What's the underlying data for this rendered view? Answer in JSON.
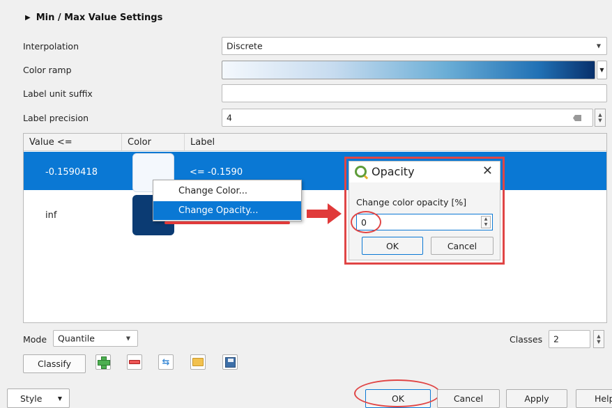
{
  "section": {
    "title": "Min / Max Value Settings"
  },
  "form": {
    "interpolation_label": "Interpolation",
    "interpolation_value": "Discrete",
    "color_ramp_label": "Color ramp",
    "label_unit_suffix_label": "Label unit suffix",
    "label_unit_suffix_value": "",
    "label_precision_label": "Label precision",
    "label_precision_value": "4"
  },
  "table": {
    "headers": [
      "Value <=",
      "Color",
      "Label"
    ],
    "rows": [
      {
        "value": "-0.1590418",
        "color": "#f4f8fd",
        "label": "<= -0.1590"
      },
      {
        "value": "inf",
        "color": "#0b3b73",
        "label": ""
      }
    ]
  },
  "context_menu": {
    "items": [
      "Change Color...",
      "Change Opacity..."
    ]
  },
  "dialog": {
    "title": "Opacity",
    "prompt": "Change color opacity [%]",
    "input_value": "0",
    "ok": "OK",
    "cancel": "Cancel"
  },
  "bottom": {
    "mode_label": "Mode",
    "mode_value": "Quantile",
    "classes_label": "Classes",
    "classes_value": "2",
    "classify": "Classify"
  },
  "footer": {
    "style": "Style",
    "ok": "OK",
    "cancel": "Cancel",
    "apply": "Apply",
    "help": "Help"
  },
  "colors": {
    "selection": "#0a78d4",
    "highlight_red": "#e04545",
    "ramp_start": "#f4f8fd",
    "ramp_end": "#08306b"
  }
}
